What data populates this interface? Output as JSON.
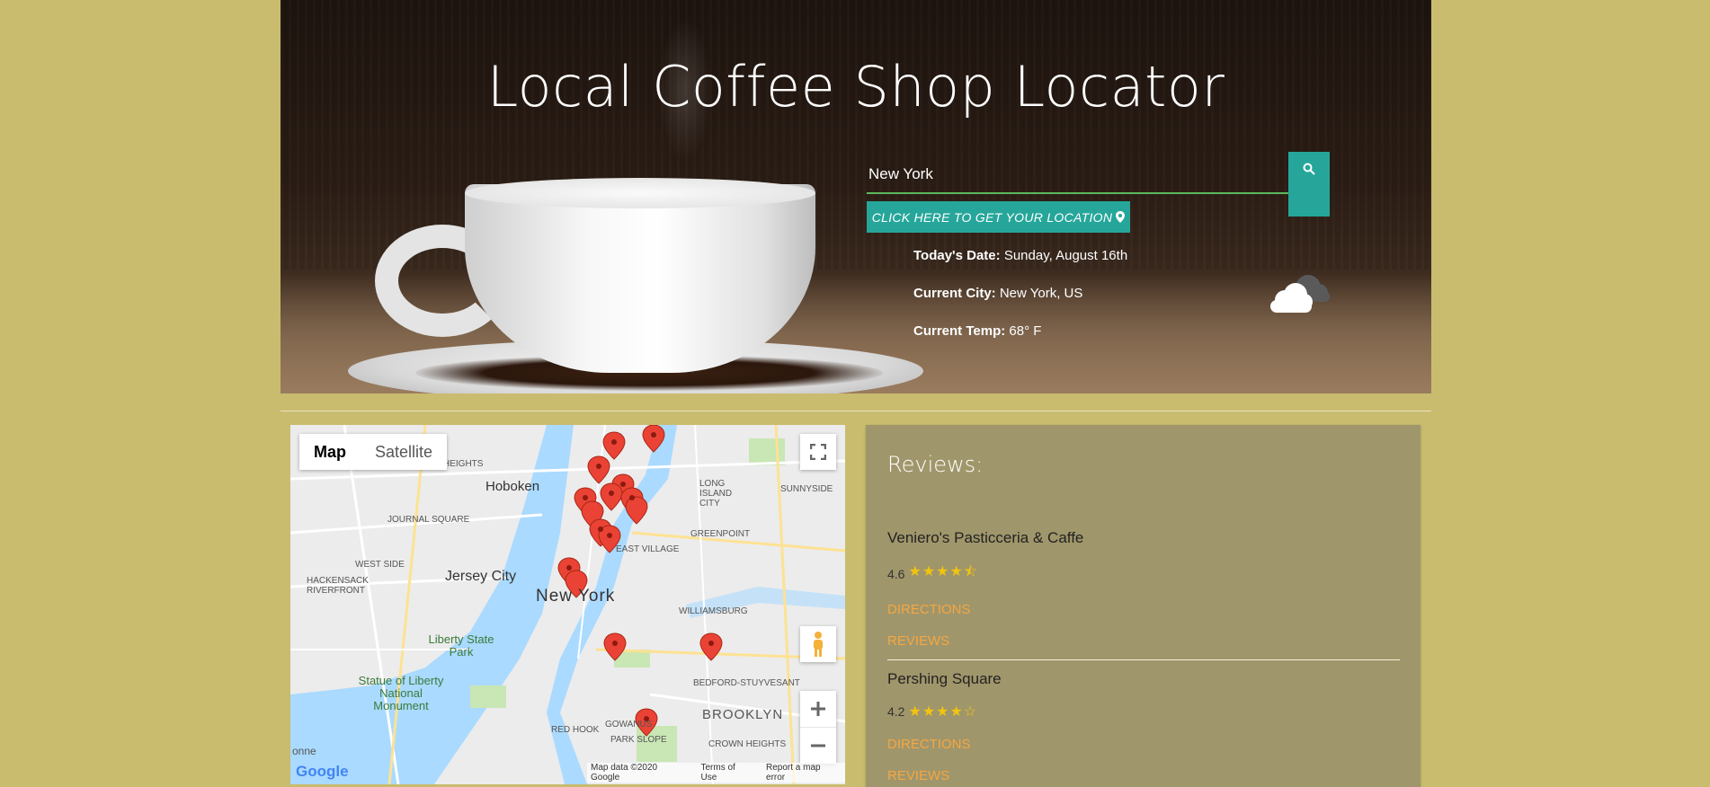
{
  "hero": {
    "title": "Local Coffee Shop Locator",
    "search_value": "New York",
    "location_button": "CLICK HERE TO GET YOUR LOCATION",
    "date_label": "Today's Date:",
    "date_value": "Sunday, August 16th",
    "city_label": "Current City:",
    "city_value": "New York, US",
    "temp_label": "Current Temp:",
    "temp_value": "68° F",
    "weather_icon": "cloud-icon"
  },
  "map": {
    "type_map": "Map",
    "type_satellite": "Satellite",
    "labels": {
      "hoboken": "Hoboken",
      "jersey_city": "Jersey City",
      "new_york": "New York",
      "liberty_park": "Liberty State Park",
      "statue": "Statue of Liberty National Monument",
      "brooklyn": "BROOKLYN",
      "williamsburg": "WILLIAMSBURG",
      "greenpoint": "GREENPOINT",
      "sunnyside": "SUNNYSIDE",
      "long_island_city": "LONG ISLAND CITY",
      "west_side": "WEST SIDE",
      "journal_square": "JOURNAL SQUARE",
      "hackensack": "HACKENSACK RIVERFRONT",
      "east_village": "EAST VILLAGE",
      "bedford": "BEDFORD-STUYVESANT",
      "red_hook": "RED HOOK",
      "gowanus": "GOWANUS",
      "park_slope": "PARK SLOPE",
      "crown_heights": "CROWN HEIGHTS",
      "heights": "HEIGHTS",
      "bayonne": "onne"
    },
    "footer_data": "Map data ©2020 Google",
    "footer_terms": "Terms of Use",
    "footer_report": "Report a map error",
    "google": "Google"
  },
  "reviews": {
    "heading": "Reviews:",
    "items": [
      {
        "name": "Veniero's Pasticceria & Caffe",
        "rating": "4.6",
        "stars": "★★★★⯪",
        "directions": "DIRECTIONS",
        "reviews": "REVIEWS"
      },
      {
        "name": "Pershing Square",
        "rating": "4.2",
        "stars": "★★★★☆",
        "directions": "DIRECTIONS",
        "reviews": "REVIEWS"
      }
    ]
  }
}
